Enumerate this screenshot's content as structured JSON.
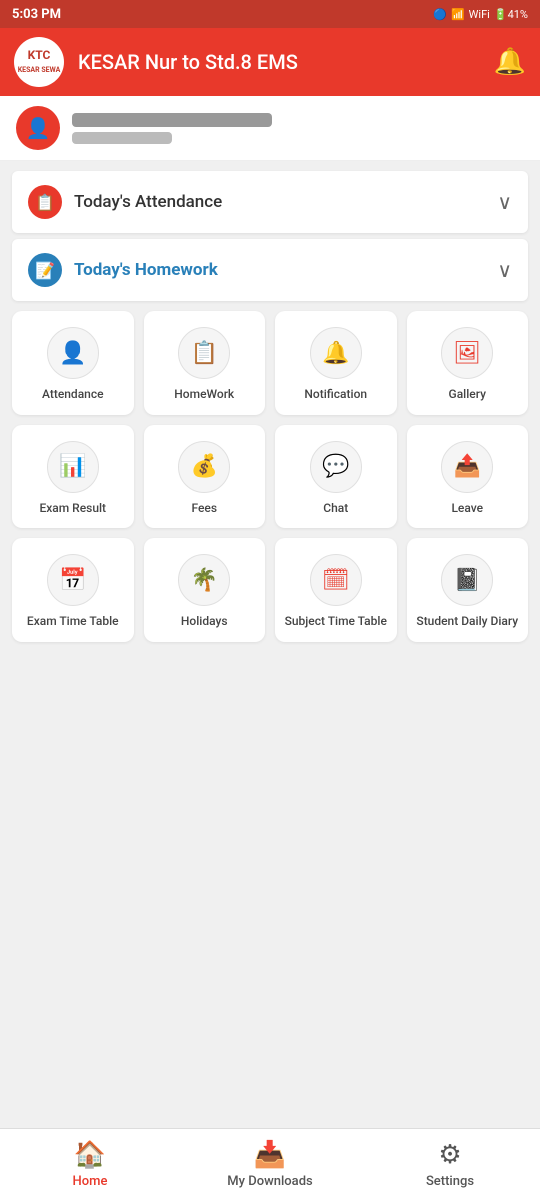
{
  "statusBar": {
    "time": "5:03 PM",
    "icons": "🔔 📶 WiFi 📶 🔋 41%"
  },
  "header": {
    "logoLine1": "KTC",
    "logoLine2": "KESAR SEWA",
    "title": "KESAR Nur to Std.8 EMS",
    "bellIcon": "bell-icon"
  },
  "userInfo": {
    "icon": "👤"
  },
  "attendance": {
    "label": "Today's Attendance",
    "icon": "📋"
  },
  "homework": {
    "label": "Today's Homework",
    "icon": "📝"
  },
  "grid": {
    "items": [
      {
        "id": "attendance",
        "label": "Attendance",
        "icon": "👤"
      },
      {
        "id": "homework",
        "label": "HomeWork",
        "icon": "📋"
      },
      {
        "id": "notification",
        "label": "Notification",
        "icon": "🔔"
      },
      {
        "id": "gallery",
        "label": "Gallery",
        "icon": "🖼"
      },
      {
        "id": "exam-result",
        "label": "Exam Result",
        "icon": "📊"
      },
      {
        "id": "fees",
        "label": "Fees",
        "icon": "💰"
      },
      {
        "id": "chat",
        "label": "Chat",
        "icon": "💬"
      },
      {
        "id": "leave",
        "label": "Leave",
        "icon": "📤"
      },
      {
        "id": "exam-time-table",
        "label": "Exam Time Table",
        "icon": "📅"
      },
      {
        "id": "holidays",
        "label": "Holidays",
        "icon": "🌴"
      },
      {
        "id": "subject-time-table",
        "label": "Subject Time Table",
        "icon": "🗓"
      },
      {
        "id": "student-daily-diary",
        "label": "Student Daily Diary",
        "icon": "📓"
      }
    ]
  },
  "bottomNav": {
    "items": [
      {
        "id": "home",
        "label": "Home",
        "icon": "🏠",
        "active": true
      },
      {
        "id": "downloads",
        "label": "My Downloads",
        "icon": "📥",
        "active": false
      },
      {
        "id": "settings",
        "label": "Settings",
        "icon": "⚙",
        "active": false
      }
    ]
  }
}
